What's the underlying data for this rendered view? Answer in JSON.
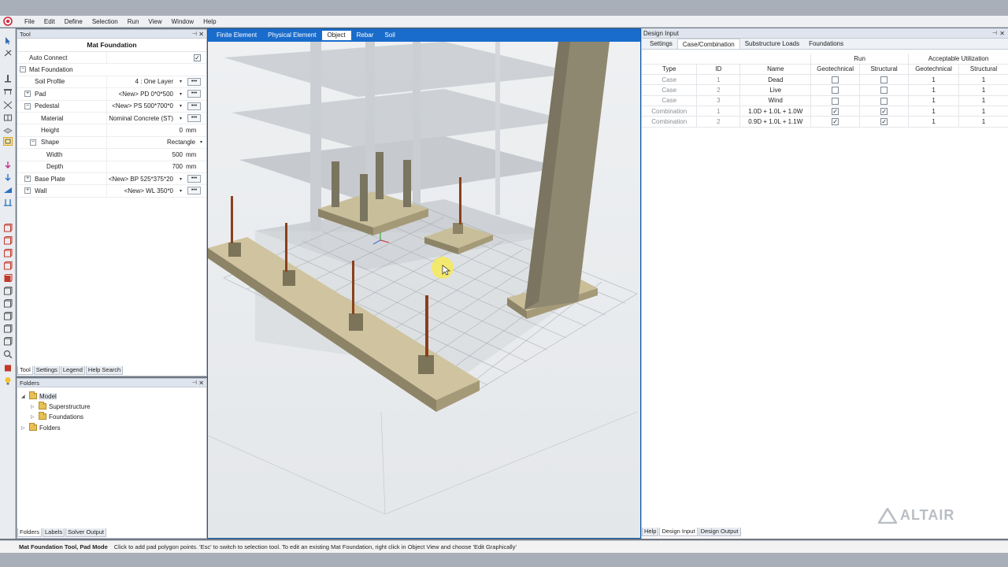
{
  "menu": [
    "File",
    "Edit",
    "Define",
    "Selection",
    "Run",
    "View",
    "Window",
    "Help"
  ],
  "tool_panel": {
    "header": "Tool",
    "title": "Mat Foundation",
    "rows": [
      {
        "label": "Auto Connect",
        "kind": "checkbox",
        "checked": "✓"
      },
      {
        "label": "Mat Foundation",
        "kind": "group",
        "toggle": "−"
      },
      {
        "label": "Soil Profile",
        "value": "4 : One Layer",
        "kind": "combo"
      },
      {
        "label": "Pad",
        "value": "<New> PD 0*0*500",
        "kind": "combo",
        "toggle": "+"
      },
      {
        "label": "Pedestal",
        "value": "<New> PS 500*700*0",
        "kind": "combo",
        "toggle": "−"
      },
      {
        "label": "Material",
        "value": "Nominal Concrete (ST)",
        "kind": "combo"
      },
      {
        "label": "Height",
        "value": "0",
        "unit": "mm",
        "kind": "number"
      },
      {
        "label": "Shape",
        "value": "Rectangle",
        "kind": "select",
        "toggle": "−"
      },
      {
        "label": "Width",
        "value": "500",
        "unit": "mm",
        "kind": "number"
      },
      {
        "label": "Depth",
        "value": "700",
        "unit": "mm",
        "kind": "number"
      },
      {
        "label": "Base Plate",
        "value": "<New> BP 525*375*20",
        "kind": "combo",
        "toggle": "+"
      },
      {
        "label": "Wall",
        "value": "<New> WL 350*0",
        "kind": "combo",
        "toggle": "+"
      }
    ],
    "tabs": [
      "Tool",
      "Settings",
      "Legend",
      "Help Search"
    ]
  },
  "folders_panel": {
    "header": "Folders",
    "tree": [
      {
        "label": "Model",
        "level": 0,
        "arrow": "◢"
      },
      {
        "label": "Superstructure",
        "level": 1,
        "arrow": "▷"
      },
      {
        "label": "Foundations",
        "level": 1,
        "arrow": "▷"
      },
      {
        "label": "Folders",
        "level": 0,
        "arrow": "▷"
      }
    ],
    "tabs": [
      "Folders",
      "Labels",
      "Solver Output"
    ]
  },
  "viewport": {
    "tabs": [
      "Finite Element",
      "Physical Element",
      "Object",
      "Rebar",
      "Soil"
    ],
    "active_tab": "Object"
  },
  "design_input": {
    "header": "Design Input",
    "subtabs": [
      "Settings",
      "Case/Combination",
      "Substructure Loads",
      "Foundations"
    ],
    "active_subtab": "Case/Combination",
    "group_headers": {
      "run": "Run",
      "util": "Acceptable Utilization"
    },
    "columns": [
      "Type",
      "ID",
      "Name",
      "Geotechnical",
      "Structural",
      "Geotechnical",
      "Structural"
    ],
    "rows": [
      {
        "type": "Case",
        "id": "1",
        "name": "Dead",
        "run_geo": "",
        "run_str": "",
        "util_geo": "1",
        "util_str": "1"
      },
      {
        "type": "Case",
        "id": "2",
        "name": "Live",
        "run_geo": "",
        "run_str": "",
        "util_geo": "1",
        "util_str": "1"
      },
      {
        "type": "Case",
        "id": "3",
        "name": "Wind",
        "run_geo": "",
        "run_str": "",
        "util_geo": "1",
        "util_str": "1"
      },
      {
        "type": "Combination",
        "id": "1",
        "name": "1.0D + 1.0L + 1.0W",
        "run_geo": "✓",
        "run_str": "✓",
        "util_geo": "1",
        "util_str": "1"
      },
      {
        "type": "Combination",
        "id": "2",
        "name": "0.9D + 1.0L + 1.1W",
        "run_geo": "✓",
        "run_str": "✓",
        "util_geo": "1",
        "util_str": "1"
      }
    ],
    "bottom_tabs": [
      "Help",
      "Design Input",
      "Design Output"
    ]
  },
  "watermark": "ALTAIR",
  "status": {
    "mode": "Mat Foundation Tool, Pad Mode",
    "message": "Click to add pad polygon points. 'Esc' to switch to selection tool. To edit an existing Mat Foundation, right click in Object View and choose 'Edit Graphically'"
  }
}
